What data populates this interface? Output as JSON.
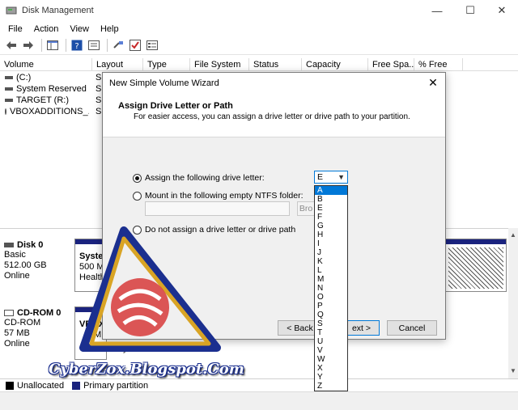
{
  "window": {
    "title": "Disk Management",
    "minimize": "—",
    "maximize": "☐",
    "close": "✕"
  },
  "menu": [
    "File",
    "Action",
    "View",
    "Help"
  ],
  "volume_list": {
    "columns": [
      "Volume",
      "Layout",
      "Type",
      "File System",
      "Status",
      "Capacity",
      "Free Spa...",
      "% Free"
    ],
    "rows": [
      {
        "name": "(C:)",
        "layout": "Si"
      },
      {
        "name": "System Reserved",
        "layout": "Si"
      },
      {
        "name": "TARGET (R:)",
        "layout": "Si"
      },
      {
        "name": "VBOXADDITIONS_...",
        "layout": "Si"
      }
    ]
  },
  "disks": [
    {
      "title": "Disk 0",
      "lines": [
        "Basic",
        "512.00 GB",
        "Online"
      ],
      "partition_lines": [
        "Syster",
        "500 M",
        "Health"
      ]
    },
    {
      "title": "CD-ROM 0",
      "lines": [
        "CD-ROM",
        "57 MB",
        "Online"
      ],
      "partition_lines": [
        "VBOX",
        "M",
        "mary Partition"
      ]
    }
  ],
  "legend": [
    {
      "label": "Unallocated",
      "color": "#000000"
    },
    {
      "label": "Primary partition",
      "color": "#1a237e"
    }
  ],
  "wizard": {
    "title": "New Simple Volume Wizard",
    "close": "✕",
    "heading": "Assign Drive Letter or Path",
    "subheading": "For easier access, you can assign a drive letter or drive path to your partition.",
    "options": [
      {
        "label": "Assign the following drive letter:",
        "selected": true
      },
      {
        "label": "Mount in the following empty NTFS folder:",
        "selected": false
      },
      {
        "label": "Do not assign a drive letter or drive path",
        "selected": false
      }
    ],
    "browse_label": "Bro",
    "drive_letter": "E",
    "drive_options": [
      "A",
      "B",
      "E",
      "F",
      "G",
      "H",
      "I",
      "J",
      "K",
      "L",
      "M",
      "N",
      "O",
      "P",
      "Q",
      "S",
      "T",
      "U",
      "V",
      "W",
      "X",
      "Y",
      "Z"
    ],
    "highlighted_option": "A",
    "back_label": "< Back",
    "next_label": "ext >",
    "cancel_label": "Cancel"
  },
  "watermark": {
    "text": "CyberZox.Blogspot.Com"
  }
}
